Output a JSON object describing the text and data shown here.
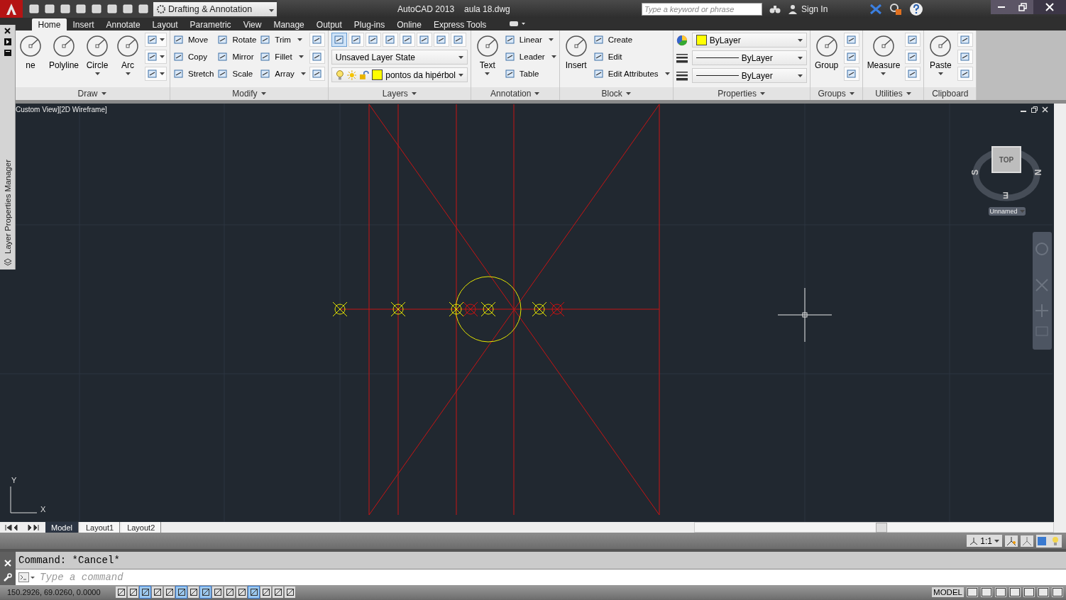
{
  "title_bar": {
    "workspace": "Drafting & Annotation",
    "app_title": "AutoCAD 2013",
    "file_name": "aula 18.dwg",
    "search": {
      "placeholder": "Type a keyword or phrase"
    },
    "sign_in": "Sign In"
  },
  "ribbon_tabs": [
    {
      "label": "Home",
      "selected": true
    },
    {
      "label": "Insert",
      "selected": false
    },
    {
      "label": "Annotate",
      "selected": false
    },
    {
      "label": "Layout",
      "selected": false
    },
    {
      "label": "Parametric",
      "selected": false
    },
    {
      "label": "View",
      "selected": false
    },
    {
      "label": "Manage",
      "selected": false
    },
    {
      "label": "Output",
      "selected": false
    },
    {
      "label": "Plug-ins",
      "selected": false
    },
    {
      "label": "Online",
      "selected": false
    },
    {
      "label": "Express Tools",
      "selected": false
    }
  ],
  "panels": [
    {
      "title": "Draw",
      "caret": true,
      "columns": [
        [
          {
            "kind": "large",
            "label": "ne",
            "caret": false
          }
        ],
        [
          {
            "kind": "large",
            "label": "Polyline",
            "caret": false
          }
        ],
        [
          {
            "kind": "large",
            "label": "Circle",
            "caret": true
          }
        ],
        [
          {
            "kind": "large",
            "label": "Arc",
            "caret": true
          }
        ],
        [
          {
            "kind": "icon",
            "caret": true
          },
          {
            "kind": "icon",
            "caret": true
          },
          {
            "kind": "icon",
            "caret": true
          }
        ]
      ]
    },
    {
      "title": "Modify",
      "caret": true,
      "columns": [
        [
          {
            "kind": "small",
            "label": "Move",
            "caret": false
          },
          {
            "kind": "small",
            "label": "Copy",
            "caret": false
          },
          {
            "kind": "small",
            "label": "Stretch",
            "caret": false
          }
        ],
        [
          {
            "kind": "small",
            "label": "Rotate",
            "caret": false
          },
          {
            "kind": "small",
            "label": "Mirror",
            "caret": false
          },
          {
            "kind": "small",
            "label": "Scale",
            "caret": false
          }
        ],
        [
          {
            "kind": "small",
            "label": "Trim",
            "caret": true
          },
          {
            "kind": "small",
            "label": "Fillet",
            "caret": true
          },
          {
            "kind": "small",
            "label": "Array",
            "caret": true
          }
        ],
        [
          {
            "kind": "icon",
            "caret": false
          },
          {
            "kind": "icon",
            "caret": false
          },
          {
            "kind": "icon",
            "caret": false
          }
        ]
      ]
    },
    {
      "title": "Layers",
      "caret": true,
      "columns": [
        [
          {
            "kind": "iconrow"
          },
          {
            "kind": "dropdown",
            "value": "Unsaved Layer State"
          },
          {
            "kind": "layer",
            "value": "pontos da hipérbol",
            "color": "#ffff00"
          }
        ]
      ]
    },
    {
      "title": "Annotation",
      "caret": true,
      "columns": [
        [
          {
            "kind": "large",
            "label": "Text",
            "caret": true
          }
        ],
        [
          {
            "kind": "small",
            "label": "Linear",
            "caret": true
          },
          {
            "kind": "small",
            "label": "Leader",
            "caret": true
          },
          {
            "kind": "small",
            "label": "Table",
            "caret": false
          }
        ]
      ]
    },
    {
      "title": "Block",
      "caret": true,
      "columns": [
        [
          {
            "kind": "large",
            "label": "Insert",
            "caret": false
          }
        ],
        [
          {
            "kind": "small",
            "label": "Create",
            "caret": false
          },
          {
            "kind": "small",
            "label": "Edit",
            "caret": false
          },
          {
            "kind": "small",
            "label": "Edit Attributes",
            "caret": true
          }
        ]
      ]
    },
    {
      "title": "Properties",
      "caret": true,
      "columns": [
        [
          {
            "kind": "prop-color",
            "value": "ByLayer",
            "color": "#ffff00"
          },
          {
            "kind": "prop-line",
            "value": "ByLayer"
          },
          {
            "kind": "prop-line",
            "value": "ByLayer"
          }
        ]
      ]
    },
    {
      "title": "Groups",
      "caret": true,
      "columns": [
        [
          {
            "kind": "large",
            "label": "Group",
            "caret": false
          }
        ],
        [
          {
            "kind": "icon",
            "caret": false
          },
          {
            "kind": "icon",
            "caret": false
          },
          {
            "kind": "icon",
            "caret": false
          }
        ]
      ]
    },
    {
      "title": "Utilities",
      "caret": true,
      "columns": [
        [
          {
            "kind": "large",
            "label": "Measure",
            "caret": true
          }
        ],
        [
          {
            "kind": "icon",
            "caret": false
          },
          {
            "kind": "icon",
            "caret": false
          },
          {
            "kind": "icon",
            "caret": false
          }
        ]
      ]
    },
    {
      "title": "Clipboard",
      "caret": false,
      "columns": [
        [
          {
            "kind": "large",
            "label": "Paste",
            "caret": true
          }
        ],
        [
          {
            "kind": "icon",
            "caret": false
          },
          {
            "kind": "icon",
            "caret": false
          },
          {
            "kind": "icon",
            "caret": false
          }
        ]
      ]
    }
  ],
  "palette": {
    "title": "Layer Properties Manager"
  },
  "viewport": {
    "label": "Custom View][2D Wireframe]",
    "viewcube": {
      "face": "TOP",
      "west": "S",
      "east": "N",
      "south": "E",
      "view_name": "Unnamed"
    },
    "ucs": {
      "x": "X",
      "y": "Y"
    }
  },
  "layout_tabs": [
    {
      "label": "Model",
      "selected": true
    },
    {
      "label": "Layout1",
      "selected": false
    },
    {
      "label": "Layout2",
      "selected": false
    }
  ],
  "annotation_scale": "1:1",
  "command": {
    "history": "Command: *Cancel*",
    "placeholder": "Type a command"
  },
  "status_bar": {
    "coordinates": "150.2926, 69.0260, 0.0000",
    "toggles": [
      {
        "on": false
      },
      {
        "on": false
      },
      {
        "on": true
      },
      {
        "on": false
      },
      {
        "on": false
      },
      {
        "on": true
      },
      {
        "on": false
      },
      {
        "on": true
      },
      {
        "on": false
      },
      {
        "on": false
      },
      {
        "on": false
      },
      {
        "on": true
      },
      {
        "on": false
      },
      {
        "on": false
      },
      {
        "on": false
      }
    ],
    "space": "MODEL"
  }
}
